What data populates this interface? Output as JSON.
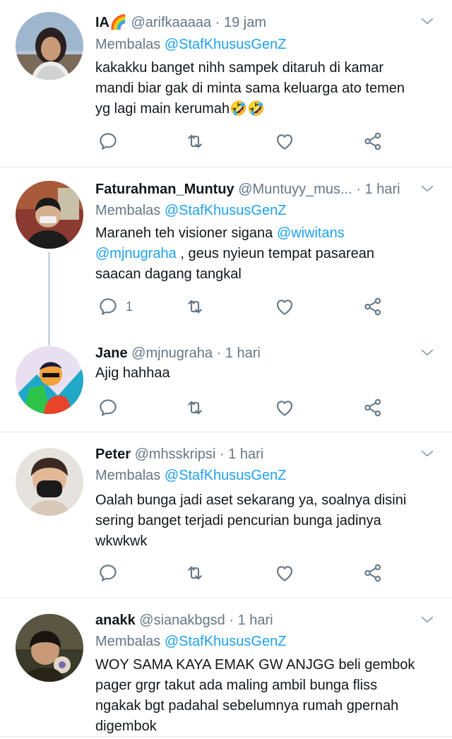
{
  "reply_prefix": "Membalas",
  "reply_target": "@StafKhususGenZ",
  "tweets": [
    {
      "name": "IA🌈",
      "handle": "@arifkaaaaa",
      "separator": "·",
      "time": "19 jam",
      "lines": [
        "kakakku banget nihh sampek ditaruh di kamar",
        "mandi biar gak di minta sama keluarga ato temen",
        "yg lagi main kerumah🤣🤣"
      ],
      "reply_count": ""
    },
    {
      "name": "Faturahman_Muntuy",
      "handle": "@Muntuyy_mus...",
      "separator": "·",
      "time": "1 hari",
      "mention1": "@wiwitans",
      "mention2": "@mjnugraha",
      "line1_pre": "Maraneh teh visioner sigana ",
      "line2_post": " , geus nyieun tempat pasarean",
      "line3": "saacan dagang tangkal",
      "reply_count": "1"
    },
    {
      "name": "Jane",
      "handle": "@mjnugraha",
      "separator": "·",
      "time": "1 hari",
      "lines": [
        "Ajig hahhaa"
      ],
      "reply_count": ""
    },
    {
      "name": "Peter",
      "handle": "@mhsskripsi",
      "separator": "·",
      "time": "1 hari",
      "lines": [
        "Oalah bunga jadi aset sekarang ya, soalnya disini",
        "sering banget terjadi pencurian bunga jadinya",
        "wkwkwk"
      ],
      "reply_count": ""
    },
    {
      "name": "anakk",
      "handle": "@sianakbgsd",
      "separator": "·",
      "time": "1 hari",
      "lines": [
        "WOY SAMA KAYA EMAK GW ANJGG beli gembok",
        "pager grgr takut ada maling ambil bunga fliss",
        "ngakak bgt padahal sebelumnya rumah gpernah",
        "digembok"
      ],
      "reply_count": ""
    }
  ],
  "icons": [
    "reply-icon",
    "retweet-icon",
    "like-icon",
    "share-icon",
    "chevron-down-icon"
  ]
}
